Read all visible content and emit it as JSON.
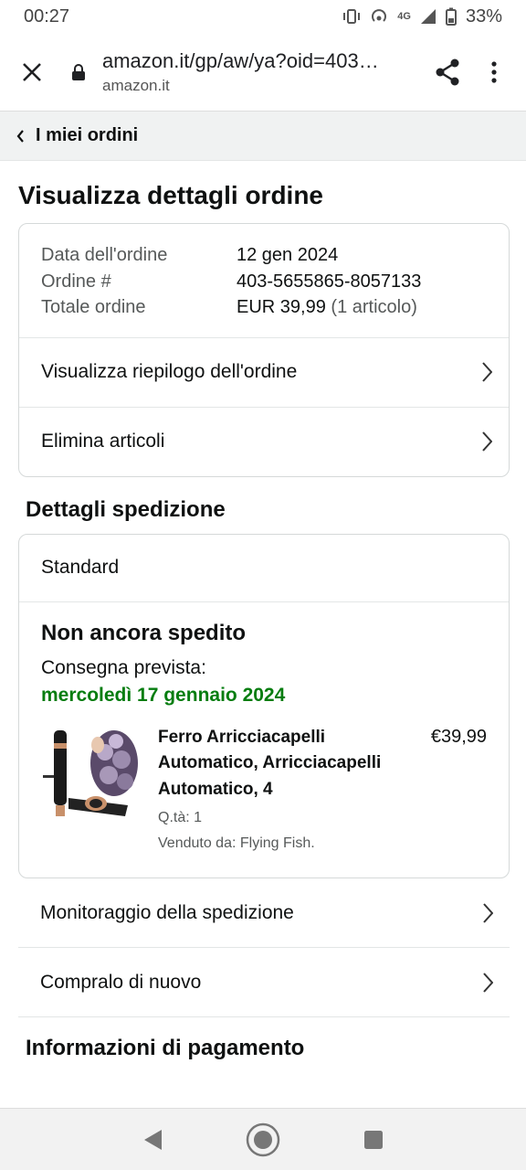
{
  "status_bar": {
    "time": "00:27",
    "network": "4G",
    "battery": "33%"
  },
  "browser": {
    "url": "amazon.it/gp/aw/ya?oid=403…",
    "domain": "amazon.it"
  },
  "breadcrumb": {
    "label": "I miei ordini"
  },
  "page_title": "Visualizza dettagli ordine",
  "order_summary": {
    "rows": [
      {
        "label": "Data dell'ordine",
        "value": "12 gen 2024",
        "extra": ""
      },
      {
        "label": "Ordine #",
        "value": "403-5655865-8057133",
        "extra": ""
      },
      {
        "label": "Totale ordine",
        "value": "EUR 39,99",
        "extra": "(1 articolo)"
      }
    ],
    "links": [
      "Visualizza riepilogo dell'ordine",
      "Elimina articoli"
    ]
  },
  "shipping": {
    "section_title": "Dettagli spedizione",
    "type": "Standard",
    "status": "Non ancora spedito",
    "expected_label": "Consegna prevista:",
    "expected_date": "mercoledì 17 gennaio 2024",
    "date_color": "#067d10",
    "product": {
      "title": "Ferro Arricciacapelli Automatico, Arricciacapelli Automatico, 4",
      "qty": "Q.tà: 1",
      "seller": "Venduto da: Flying Fish.",
      "price": "€39,99"
    },
    "actions": [
      "Monitoraggio della spedizione",
      "Compralo di nuovo"
    ]
  },
  "payment": {
    "section_title": "Informazioni di pagamento"
  }
}
